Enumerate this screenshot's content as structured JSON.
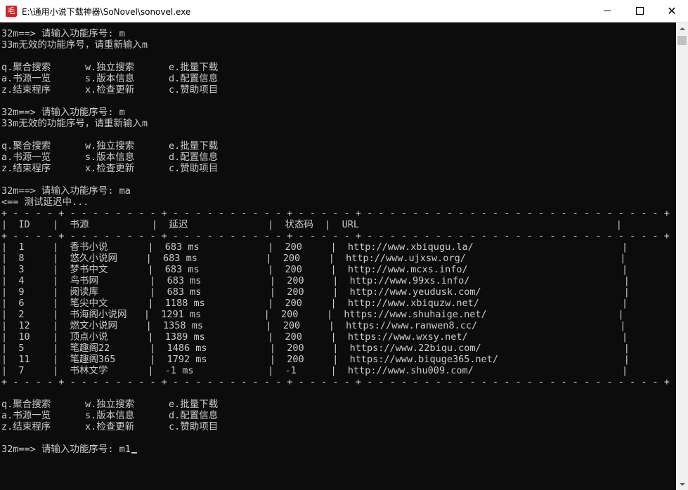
{
  "window": {
    "title": "E:\\通用小说下载神器\\SoNovel\\sonovel.exe",
    "icon_glyph": "毛"
  },
  "console": {
    "lines": [
      "32m==> 请输入功能序号: m",
      "33m无效的功能序号，请重新输入m",
      "",
      "q.聚合搜索      w.独立搜索      e.批量下载",
      "a.书源一览      s.版本信息      d.配置信息",
      "z.结束程序      x.检查更新      c.赞助项目",
      "",
      "32m==> 请输入功能序号: m",
      "33m无效的功能序号，请重新输入m",
      "",
      "q.聚合搜索      w.独立搜索      e.批量下载",
      "a.书源一览      s.版本信息      d.配置信息",
      "z.结束程序      x.检查更新      c.赞助项目",
      "",
      "32m==> 请输入功能序号: ma",
      "<== 测试延迟中...",
      "+ - - - - + - - - - - - - - + - - - - - - - - - - + - - - - - + - - - - - - - - - - - - - - - - - - - - - - - - - - +",
      "|  ID    |  书源           |  延迟              |  状态码  |  URL                                             |",
      "+ - - - - + - - - - - - - - + - - - - - - - - - - + - - - - - + - - - - - - - - - - - - - - - - - - - - - - - - - - +",
      "|  1     |  香书小说       |  683 ms            |  200     |  http://www.xbiqugu.la/                          |",
      "|  8     |  悠久小说网     |  683 ms            |  200     |  http://www.ujxsw.org/                           |",
      "|  3     |  梦书中文       |  683 ms            |  200     |  http://www.mcxs.info/                           |",
      "|  4     |  鸟书网         |  683 ms            |  200     |  http://www.99xs.info/                           |",
      "|  9     |  阅读库         |  683 ms            |  200     |  http://www.yeudusk.com/                         |",
      "|  6     |  笔尖中文       |  1188 ms           |  200     |  http://www.xbiquzw.net/                         |",
      "|  2     |  书海阁小说网   |  1291 ms           |  200     |  https://www.shuhaige.net/                       |",
      "|  12    |  燃文小说网     |  1358 ms           |  200     |  https://www.ranwen8.cc/                         |",
      "|  10    |  顶点小说       |  1389 ms           |  200     |  https://www.wxsy.net/                           |",
      "|  5     |  笔趣阁22       |  1486 ms           |  200     |  https://www.22biqu.com/                         |",
      "|  11    |  笔趣阁365      |  1792 ms           |  200     |  https://www.biquge365.net/                      |",
      "|  7     |  书林文学       |  -1 ms             |  -1      |  http://www.shu009.com/                          |",
      "+ - - - - + - - - - - - - - + - - - - - - - - - - + - - - - - + - - - - - - - - - - - - - - - - - - - - - - - - - - +",
      "",
      "q.聚合搜索      w.独立搜索      e.批量下载",
      "a.书源一览      s.版本信息      d.配置信息",
      "z.结束程序      x.检查更新      c.赞助项目",
      "",
      "32m==> 请输入功能序号: m1"
    ]
  },
  "colors": {
    "console_bg": "#0c0c0c",
    "console_fg": "#cccccc",
    "titlebar_bg": "#ffffff",
    "scrollbar_bg": "#f0f0f0",
    "scrollbar_thumb": "#c1c1c1"
  },
  "icons": {
    "minimize": "minimize-icon",
    "maximize": "maximize-icon",
    "close": "close-icon",
    "scroll_up": "arrow-up-icon",
    "scroll_down": "arrow-down-icon"
  }
}
